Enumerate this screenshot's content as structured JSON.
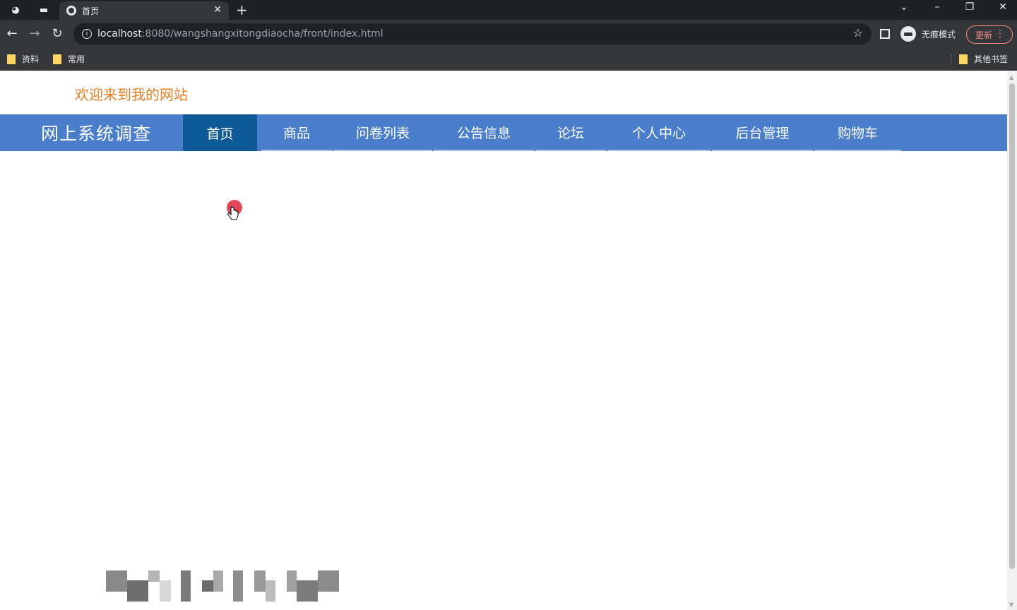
{
  "browser": {
    "tab_title": "首页",
    "url_host": "localhost",
    "url_rest": ":8080/wangshangxitongdiaocha/front/index.html",
    "incognito_label": "无痕模式",
    "update_label": "更新",
    "bookmarks": [
      "资料",
      "常用"
    ],
    "other_bookmarks": "其他书签"
  },
  "page": {
    "welcome": "欢迎来到我的网站",
    "site_title": "网上系统调查",
    "nav": [
      {
        "label": "首页",
        "active": true
      },
      {
        "label": "商品"
      },
      {
        "label": "问卷列表"
      },
      {
        "label": "公告信息"
      },
      {
        "label": "论坛"
      },
      {
        "label": "个人中心"
      },
      {
        "label": "后台管理"
      },
      {
        "label": "购物车"
      }
    ]
  },
  "colors": {
    "nav_bg": "#4a7ecb",
    "nav_active_bg": "#0e5a97",
    "welcome_text": "#e67e22"
  }
}
